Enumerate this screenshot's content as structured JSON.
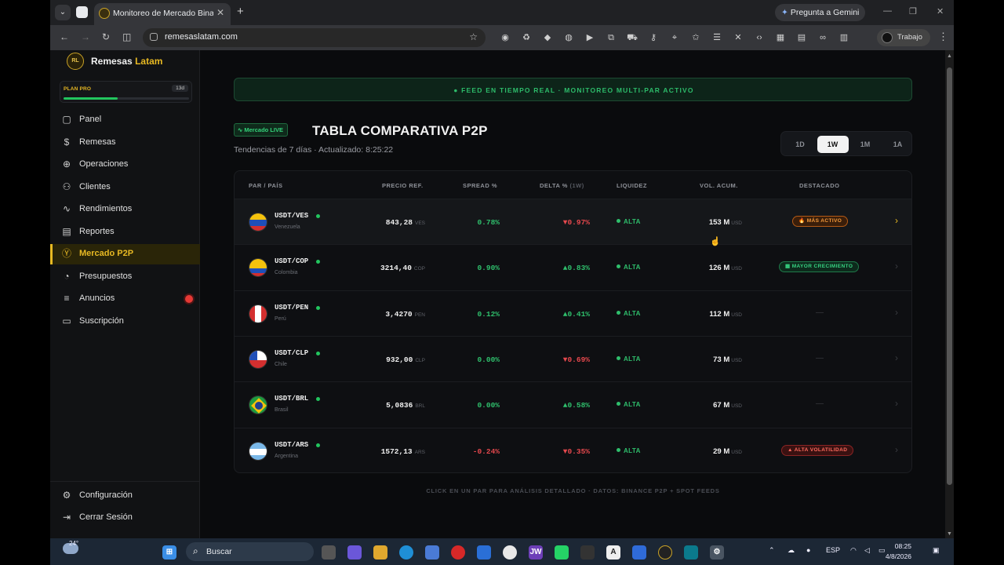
{
  "browser": {
    "tab_title": "Monitoreo de Mercado Binance",
    "gemini_label": "Pregunta a Gemini",
    "url": "remesaslatam.com",
    "profile_label": "Trabajo",
    "extensions": [
      "record-icon",
      "puzzle-ext-icon",
      "tag-icon",
      "ext-icon",
      "cast-icon",
      "extensions-icon",
      "car-icon",
      "key-icon",
      "location-icon",
      "star-icon",
      "list-icon",
      "trash-icon",
      "code-icon",
      "layout-icon",
      "media-icon",
      "link-icon",
      "sidepanel-icon"
    ]
  },
  "sidebar": {
    "brand_logo": "RL",
    "brand_a": "Remesas",
    "brand_b": "Latam",
    "plan_label": "PLAN PRO",
    "plan_days": "13d",
    "plan_progress": 0.43,
    "items": [
      {
        "label": "Panel",
        "icon": "layout-icon",
        "active": false
      },
      {
        "label": "Remesas",
        "icon": "dollar-icon",
        "active": false
      },
      {
        "label": "Operaciones",
        "icon": "compass-icon",
        "active": false
      },
      {
        "label": "Clientes",
        "icon": "users-icon",
        "active": false
      },
      {
        "label": "Rendimientos",
        "icon": "activity-icon",
        "active": false
      },
      {
        "label": "Reportes",
        "icon": "file-icon",
        "active": false
      },
      {
        "label": "Mercado P2P",
        "icon": "coin-icon",
        "active": true
      },
      {
        "label": "Presupuestos",
        "icon": "pie-icon",
        "active": false
      },
      {
        "label": "Anuncios",
        "icon": "menu-icon",
        "active": false,
        "badge": true
      },
      {
        "label": "Suscripción",
        "icon": "archive-icon",
        "active": false
      }
    ],
    "config_label": "Configuración",
    "logout_label": "Cerrar Sesión"
  },
  "main": {
    "feed_text": "● FEED EN TIEMPO REAL · MONITOREO MULTI-PAR ACTIVO",
    "live_badge": "Mercado LIVE",
    "title": "TABLA COMPARATIVA P2P",
    "subtitle": "Tendencias de 7 días · Actualizado: 8:25:22",
    "ranges": [
      "1D",
      "1W",
      "1M",
      "1A"
    ],
    "active_range": "1W",
    "columns": {
      "pair": "PAR / PAÍS",
      "price": "PRECIO REF.",
      "spread": "SPREAD %",
      "delta": "DELTA %",
      "delta_note": "(1W)",
      "liquidity": "LIQUIDEZ",
      "volume": "VOL. ACUM.",
      "featured": "DESTACADO"
    },
    "rows": [
      {
        "pair": "USDT/VES",
        "country": "Venezuela",
        "flag": "ve",
        "price": "843,28",
        "price_unit": "VES",
        "spread": "0.78%",
        "spread_sign": "pos",
        "delta": "▼0.97%",
        "delta_sign": "neg",
        "liquidity": "ALTA",
        "volume": "153 M",
        "volume_unit": "USD",
        "badge": "🔥 MÁS ACTIVO",
        "badge_type": "orange"
      },
      {
        "pair": "USDT/COP",
        "country": "Colombia",
        "flag": "co",
        "price": "3214,40",
        "price_unit": "COP",
        "spread": "0.90%",
        "spread_sign": "pos",
        "delta": "▲0.83%",
        "delta_sign": "pos",
        "liquidity": "ALTA",
        "volume": "126 M",
        "volume_unit": "USD",
        "badge": "▦ MAYOR CRECIMIENTO",
        "badge_type": "green"
      },
      {
        "pair": "USDT/PEN",
        "country": "Perú",
        "flag": "pe",
        "price": "3,4270",
        "price_unit": "PEN",
        "spread": "0.12%",
        "spread_sign": "pos",
        "delta": "▲0.41%",
        "delta_sign": "pos",
        "liquidity": "ALTA",
        "volume": "112 M",
        "volume_unit": "USD",
        "badge": "—",
        "badge_type": "none"
      },
      {
        "pair": "USDT/CLP",
        "country": "Chile",
        "flag": "cl",
        "price": "932,00",
        "price_unit": "CLP",
        "spread": "0.00%",
        "spread_sign": "pos",
        "delta": "▼0.69%",
        "delta_sign": "neg",
        "liquidity": "ALTA",
        "volume": "73 M",
        "volume_unit": "USD",
        "badge": "—",
        "badge_type": "none"
      },
      {
        "pair": "USDT/BRL",
        "country": "Brasil",
        "flag": "br",
        "price": "5,0836",
        "price_unit": "BRL",
        "spread": "0.00%",
        "spread_sign": "pos",
        "delta": "▲0.58%",
        "delta_sign": "pos",
        "liquidity": "ALTA",
        "volume": "67 M",
        "volume_unit": "USD",
        "badge": "—",
        "badge_type": "none"
      },
      {
        "pair": "USDT/ARS",
        "country": "Argentina",
        "flag": "ar",
        "price": "1572,13",
        "price_unit": "ARS",
        "spread": "-0.24%",
        "spread_sign": "neg",
        "delta": "▼0.35%",
        "delta_sign": "neg",
        "liquidity": "ALTA",
        "volume": "29 M",
        "volume_unit": "USD",
        "badge": "▲ ALTA VOLATILIDAD",
        "badge_type": "red"
      }
    ],
    "footnote": "CLICK EN UN PAR PARA ANÁLISIS DETALLADO · DATOS: BINANCE P2P + SPOT FEEDS"
  },
  "taskbar": {
    "temperature": "24°",
    "search_label": "Buscar",
    "language": "ESP",
    "time": "08:25",
    "date": "4/8/2026"
  }
}
